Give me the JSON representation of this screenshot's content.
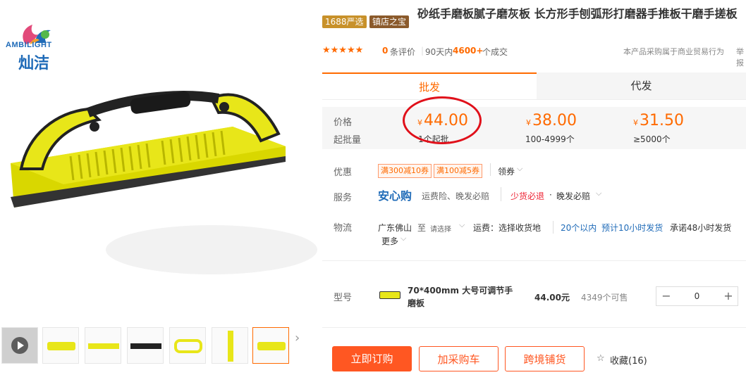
{
  "brand": {
    "logo_text": "AMBILIGHT",
    "logo_cn": "灿洁"
  },
  "badges": [
    {
      "label": "1688严选",
      "color": "#c8912a"
    },
    {
      "label": "镇店之宝",
      "color": "#8b5a2b"
    }
  ],
  "product": {
    "title": "砂纸手磨板腻子磨灰板 长方形手刨弧形打磨器手推板干磨手搓板",
    "rating_stars": "★★★★★",
    "review_count": "0",
    "review_label": "条评价",
    "sales_period": "90天内",
    "sales_count": "4600+",
    "sales_label": "个成交",
    "trade_note": "本产品采购属于商业贸易行为",
    "trade_note_tail": "举报"
  },
  "tabs": [
    {
      "label": "批发"
    },
    {
      "label": "代发"
    }
  ],
  "pricing": {
    "price_label": "价格",
    "moq_label": "起批量",
    "currency": "¥",
    "tiers": [
      {
        "price": "44.00",
        "range": "1个起批"
      },
      {
        "price": "38.00",
        "range": "100-4999个"
      },
      {
        "price": "31.50",
        "range": "≥5000个"
      }
    ]
  },
  "promo": {
    "label": "优惠",
    "coupons": [
      "满300减10券",
      "满100减5券"
    ],
    "get_coupon": "领券"
  },
  "service": {
    "label": "服务",
    "brand": "安心购",
    "items": "运费险、晚发必赔",
    "highlight": "少货必退",
    "extra": "晚发必赔",
    "sep": "·"
  },
  "logistics": {
    "label": "物流",
    "origin": "广东佛山",
    "to": "至",
    "select": "请选择",
    "freight": "运费：选择收货地",
    "within": "20个以内",
    "eta": "预计10小时发货",
    "promise": "承诺48小时发货",
    "more": "更多"
  },
  "sku": {
    "label": "型号",
    "name": "70*400mm 大号可调节手磨板",
    "price": "44.00元",
    "stock": "4349个可售",
    "qty": "0",
    "minus": "−",
    "plus": "+"
  },
  "actions": {
    "buy": "立即订购",
    "cart": "加采购车",
    "cross": "跨境铺货",
    "fav": "收藏(16)"
  },
  "colors": {
    "accent": "#ff6a00",
    "product_yellow": "#e8e619",
    "annotation_red": "#e0101a"
  }
}
